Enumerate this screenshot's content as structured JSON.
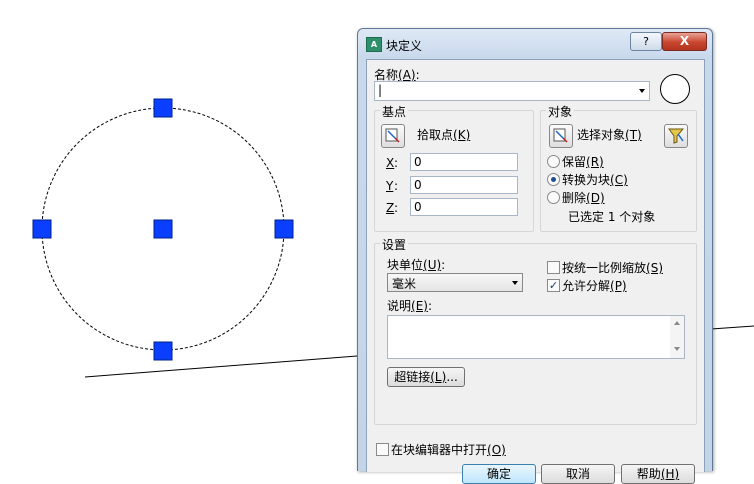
{
  "canvas": {
    "grip_color": "#0a3fff"
  },
  "dialog": {
    "title": "块定义",
    "help_glyph": "?",
    "close_glyph": "X",
    "name_label": "名称",
    "name_key": "(A)",
    "name_colon": ":",
    "name_value": "|",
    "base_point": {
      "title": "基点",
      "pick_label": "拾取点",
      "pick_key": "(K)",
      "x_label": "X",
      "y_label": "Y",
      "z_label": "Z",
      "x_value": "0",
      "y_value": "0",
      "z_value": "0"
    },
    "objects": {
      "title": "对象",
      "select_label": "选择对象",
      "select_key": "(T)",
      "options": [
        {
          "label": "保留",
          "key": "(R)",
          "selected": false
        },
        {
          "label": "转换为块",
          "key": "(C)",
          "selected": true
        },
        {
          "label": "删除",
          "key": "(D)",
          "selected": false
        }
      ],
      "status": "已选定 1 个对象"
    },
    "settings": {
      "title": "设置",
      "unit_label": "块单位",
      "unit_key": "(U)",
      "unit_colon": ":",
      "unit_value": "毫米",
      "scale_label": "按统一比例缩放",
      "scale_key": "(S)",
      "scale_checked": false,
      "explode_label": "允许分解",
      "explode_key": "(P)",
      "explode_checked": true,
      "desc_label": "说明",
      "desc_key": "(E)",
      "desc_colon": ":",
      "desc_value": "",
      "hyperlink_label": "超链接",
      "hyperlink_key": "(L)",
      "hyperlink_dots": "..."
    },
    "open_editor_label": "在块编辑器中打开",
    "open_editor_key": "(O)",
    "open_editor_checked": false,
    "ok_label": "确定",
    "cancel_label": "取消",
    "help_label": "帮助",
    "help_key": "(H)"
  }
}
